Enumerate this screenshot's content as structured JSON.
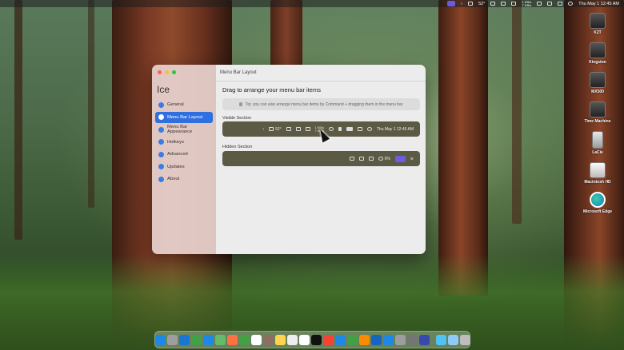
{
  "menubar": {
    "temperature": "52°",
    "network_up": "1 KB/s",
    "network_down": "7 KB/s",
    "datetime": "Thu May 1  12:45 AM",
    "items": [
      "ice-icon",
      "chevron-left-icon",
      "cloud-icon",
      "grid-icon",
      "pause-icon",
      "square-icon",
      "network-stats-icon",
      "display-icon",
      "text-icon",
      "window-icon",
      "dots-icon",
      "record-icon",
      "control-center-icon"
    ]
  },
  "desktop": {
    "items": [
      {
        "label": "K2T",
        "icon": "camera-drive-icon"
      },
      {
        "label": "Kingston",
        "icon": "camera-drive-icon"
      },
      {
        "label": "MX500",
        "icon": "camera-drive-icon"
      },
      {
        "label": "Time Machine",
        "icon": "time-machine-icon"
      },
      {
        "label": "LaCie",
        "icon": "external-drive-icon"
      },
      {
        "label": "Macintosh HD",
        "icon": "internal-drive-icon"
      },
      {
        "label": "Microsoft Edge",
        "icon": "edge-icon"
      }
    ]
  },
  "window": {
    "app_title": "Ice",
    "title": "Menu Bar Layout",
    "nav": [
      {
        "label": "General",
        "icon": "gear-icon",
        "active": false
      },
      {
        "label": "Menu Bar Layout",
        "icon": "layout-icon",
        "active": true
      },
      {
        "label": "Menu Bar Appearance",
        "icon": "paintbrush-icon",
        "active": false
      },
      {
        "label": "Hotkeys",
        "icon": "keyboard-icon",
        "active": false
      },
      {
        "label": "Advanced",
        "icon": "gears-icon",
        "active": false
      },
      {
        "label": "Updates",
        "icon": "arrow-circle-icon",
        "active": false
      },
      {
        "label": "About",
        "icon": "cube-icon",
        "active": false
      }
    ],
    "heading": "Drag to arrange your menu bar items",
    "tip": "Tip: you can also arrange menu bar items by Command + dragging them in the menu bar",
    "visible_section": {
      "label": "Visible Section",
      "temperature": "52°",
      "network_up": "1 KB/s",
      "network_down": "7 KB/s",
      "datetime": "Thu May 1  12:45 AM"
    },
    "hidden_section": {
      "label": "Hidden Section",
      "battery": "0%"
    }
  },
  "dock": {
    "apps": [
      "finder-icon",
      "launchpad-icon",
      "safari-icon",
      "messages-icon",
      "mail-icon",
      "maps-icon",
      "photos-icon",
      "facetime-icon",
      "calendar-icon",
      "contacts-icon",
      "notes-icon",
      "reminders-icon",
      "freeform-icon",
      "appletv-icon",
      "music-icon",
      "keynote-icon",
      "numbers-icon",
      "pages-icon",
      "xcode-icon",
      "appstore-icon",
      "system-settings-icon",
      "script-editor-icon",
      "ice-app-icon",
      "preview-icon",
      "downloads-icon",
      "trash-icon"
    ],
    "colors": [
      "#1e88e5",
      "#9e9e9e",
      "#1976d2",
      "#43a047",
      "#1e88e5",
      "#66bb6a",
      "#ff7043",
      "#43a047",
      "#ffffff",
      "#8d6e63",
      "#ffd54f",
      "#eeeeee",
      "#ffffff",
      "#111111",
      "#f44336",
      "#1e88e5",
      "#43a047",
      "#fb8c00",
      "#1565c0",
      "#1e88e5",
      "#9e9e9e",
      "#757575",
      "#3949ab",
      "#4fc3f7",
      "#90caf9",
      "#bdbdbd"
    ]
  }
}
